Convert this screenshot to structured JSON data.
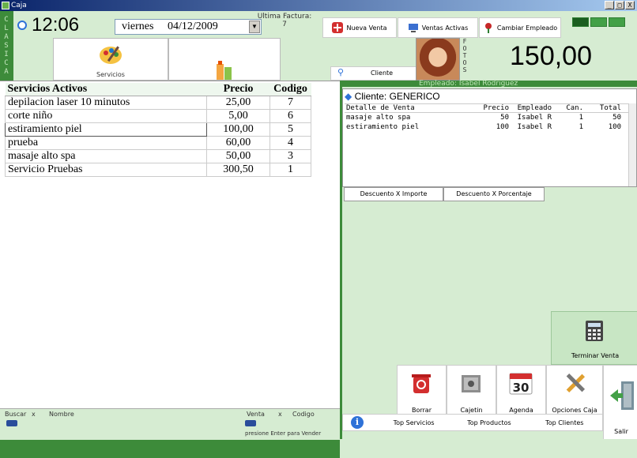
{
  "window": {
    "title": "Caja",
    "controls": [
      "_",
      "□",
      "X"
    ]
  },
  "sidebar": {
    "vertical_label": "CLASICA"
  },
  "header": {
    "time": "12:06",
    "day": "viernes",
    "date": "04/12/2009",
    "ultima_factura_label": "Ultima Factura:",
    "ultima_factura_value": "7",
    "buttons": {
      "nueva_venta": "Nueva Venta",
      "ventas_activas": "Ventas Activas",
      "cambiar_empleado": "Cambiar Empleado"
    },
    "fotos_label": "FOTOS",
    "total": "150,00"
  },
  "tabs": {
    "servicios": "Servicios",
    "productos": ""
  },
  "services_table": {
    "headers": [
      "Servicios Activos",
      "Precio",
      "Codigo"
    ],
    "rows": [
      [
        "depilacion laser 10 minutos",
        "25,00",
        "7"
      ],
      [
        "corte niño",
        "5,00",
        "6"
      ],
      [
        "estiramiento piel",
        "100,00",
        "5"
      ],
      [
        "prueba",
        "60,00",
        "4"
      ],
      [
        "masaje alto spa",
        "50,00",
        "3"
      ],
      [
        "Servicio Pruebas",
        "300,50",
        "1"
      ]
    ]
  },
  "search": {
    "buscar_label": "Buscar",
    "x1": "x",
    "nombre_label": "Nombre",
    "venta_label": "Venta",
    "x2": "x",
    "codigo_label": "Codigo",
    "hint": "presione Enter para Vender"
  },
  "sale": {
    "cliente_button": "Cliente",
    "empleado_line": "Empleado: Isabel Rodriguez",
    "cliente_line": "Cliente: GENERICO",
    "detail_headers": [
      "Detalle de Venta",
      "Precio",
      "Empleado",
      "Can.",
      "Total"
    ],
    "detail_rows": [
      [
        "masaje alto spa",
        "50",
        "Isabel R",
        "1",
        "50"
      ],
      [
        "estiramiento piel",
        "100",
        "Isabel R",
        "1",
        "100"
      ]
    ],
    "descuento_importe": "Descuento X Importe",
    "descuento_porcentaje": "Descuento X Porcentaje"
  },
  "actions": {
    "terminar_venta": "Terminar Venta",
    "borrar": "Borrar",
    "cajetin": "Cajetin",
    "agenda": "Agenda",
    "agenda_day": "30",
    "opciones_caja": "Opciones Caja",
    "salir": "Salir",
    "top_servicios": "Top Servicios",
    "top_productos": "Top Productos",
    "top_clientes": "Top Clientes"
  },
  "colors": {
    "accent_green": "#3d8b3a",
    "panel_green": "#d6ecd2",
    "titlebar_blue": "#0a246a"
  }
}
